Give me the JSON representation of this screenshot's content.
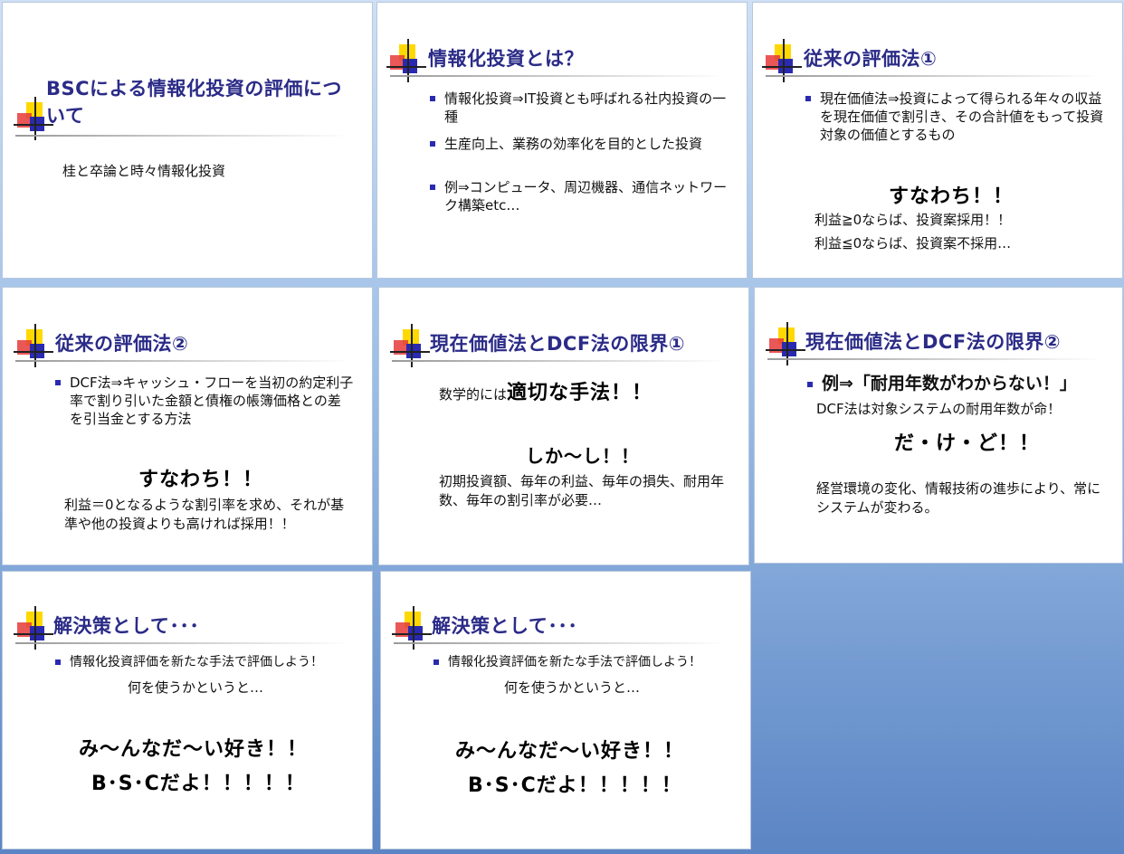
{
  "slides": [
    {
      "title": "BSCによる情報化投資の評価について",
      "body": "桂と卒論と時々情報化投資"
    },
    {
      "title": "情報化投資とは？",
      "bullets": [
        "情報化投資⇒IT投資とも呼ばれる社内投資の一種",
        "生産向上、業務の効率化を目的とした投資",
        "例⇒コンピュータ、周辺機器、通信ネットワーク構築etc…"
      ]
    },
    {
      "title": "従来の評価法①",
      "bullets": [
        "現在価値法⇒投資によって得られる年々の収益を現在価値で割引き、その合計値をもって投資対象の価値とするもの"
      ],
      "emphasis": "すなわち！！",
      "lines": [
        "利益≧0ならば、投資案採用！！",
        "利益≦0ならば、投資案不採用…"
      ]
    },
    {
      "title": "従来の評価法②",
      "bullets": [
        "DCF法⇒キャッシュ・フローを当初の約定利子率で割り引いた金額と債権の帳簿価格との差を引当金とする方法"
      ],
      "emphasis": "すなわち！！",
      "body": "利益＝0となるような割引率を求め、それが基準や他の投資よりも高ければ採用！！"
    },
    {
      "title": "現在価値法とDCF法の限界①",
      "lead_small": "数学的には",
      "lead_big": "適切な手法！！",
      "emphasis": "しか～し！！",
      "body": "初期投資額、毎年の利益、毎年の損失、耐用年数、毎年の割引率が必要…"
    },
    {
      "title": "現在価値法とDCF法の限界②",
      "bullets": [
        "例⇒「耐用年数がわからない！」"
      ],
      "line": "DCF法は対象システムの耐用年数が命！",
      "emphasis": "だ・け・ど！！",
      "body": "経営環境の変化、情報技術の進歩により、常にシステムが変わる。"
    },
    {
      "title": "解決策として･･･",
      "bullets": [
        "情報化投資評価を新たな手法で評価しよう！"
      ],
      "line": "何を使うかというと…",
      "big1": "み～んなだ～い好き！！",
      "big2": "B･S･Cだよ！！！！！"
    },
    {
      "title": "解決策として･･･",
      "bullets": [
        "情報化投資評価を新たな手法で評価しよう！"
      ],
      "line": "何を使うかというと…",
      "big1": "み～んなだ～い好き！！",
      "big2": "B･S･Cだよ！！！！！"
    }
  ],
  "colors": {
    "title": "#2b2b88",
    "bullet": "#2a2ab0",
    "deco_yellow": "#ffd800",
    "deco_red": "#e63a3a",
    "deco_blue": "#2a2ab0",
    "background": "#9bbde6"
  }
}
